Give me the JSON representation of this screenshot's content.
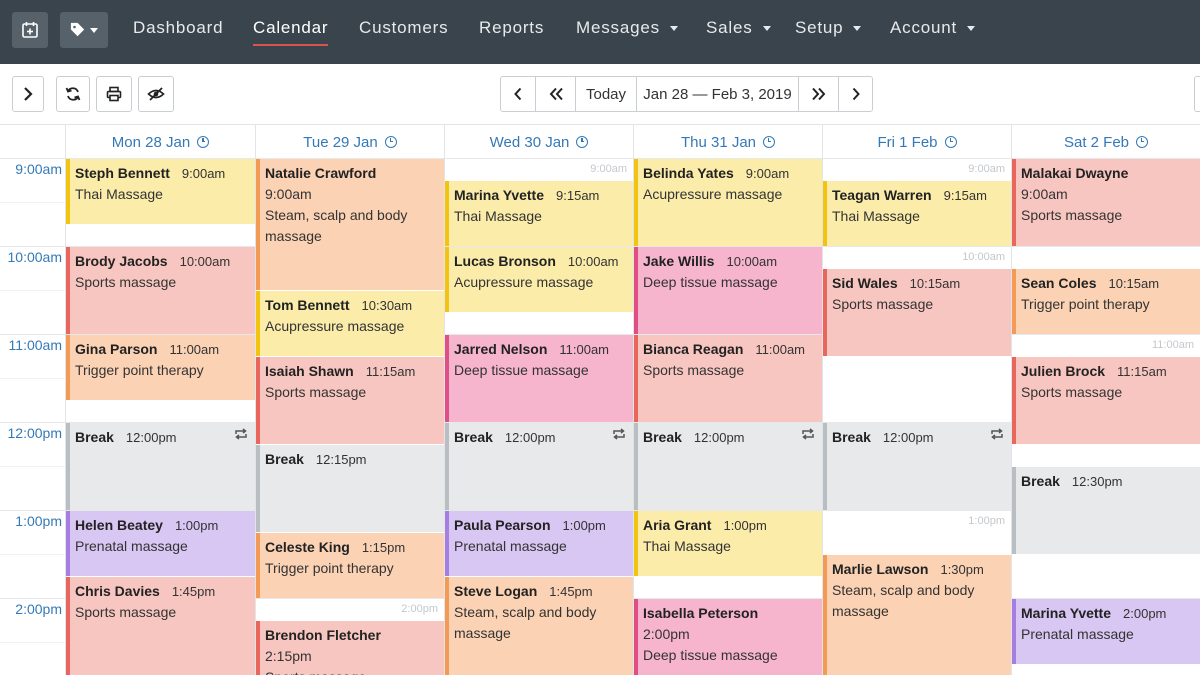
{
  "nav": {
    "items": [
      {
        "label": "Dashboard",
        "dropdown": false,
        "active": false
      },
      {
        "label": "Calendar",
        "dropdown": false,
        "active": true
      },
      {
        "label": "Customers",
        "dropdown": false,
        "active": false
      },
      {
        "label": "Reports",
        "dropdown": false,
        "active": false
      },
      {
        "label": "Messages",
        "dropdown": true,
        "active": false
      },
      {
        "label": "Sales",
        "dropdown": true,
        "active": false
      },
      {
        "label": "Setup",
        "dropdown": true,
        "active": false
      },
      {
        "label": "Account",
        "dropdown": true,
        "active": false
      }
    ]
  },
  "toolbar": {
    "today_label": "Today",
    "date_range": "Jan 28 — Feb 3, 2019"
  },
  "days": [
    {
      "label": "Mon 28 Jan"
    },
    {
      "label": "Tue 29 Jan"
    },
    {
      "label": "Wed 30 Jan"
    },
    {
      "label": "Thu 31 Jan"
    },
    {
      "label": "Fri 1 Feb"
    },
    {
      "label": "Sat 2 Feb"
    }
  ],
  "time_labels": [
    "9:00am",
    "10:00am",
    "11:00am",
    "12:00pm",
    "1:00pm",
    "2:00pm"
  ],
  "empty_slots": [
    {
      "day": 2,
      "label": "9:00am"
    },
    {
      "day": 4,
      "label": "9:00am"
    },
    {
      "day": 4,
      "label": "10:00am"
    },
    {
      "day": 5,
      "label": "11:00am"
    },
    {
      "day": 4,
      "label": "1:00pm"
    },
    {
      "day": 1,
      "label": "2:00pm"
    }
  ],
  "appointments": [
    {
      "day": 0,
      "name": "Steph Bennett",
      "time": "9:00am",
      "service": "Thai Massage",
      "color": "yellow",
      "start": "9:00",
      "end": "9:45",
      "layout": "inline"
    },
    {
      "day": 0,
      "name": "Brody Jacobs",
      "time": "10:00am",
      "service": "Sports massage",
      "color": "red",
      "start": "10:00",
      "end": "11:00",
      "layout": "inline"
    },
    {
      "day": 0,
      "name": "Gina Parson",
      "time": "11:00am",
      "service": "Trigger point therapy",
      "color": "orange",
      "start": "11:00",
      "end": "11:45",
      "layout": "inline"
    },
    {
      "day": 0,
      "name": "Break",
      "time": "12:00pm",
      "service": "",
      "color": "grey",
      "start": "12:00",
      "end": "13:00",
      "layout": "inline",
      "repeat": true
    },
    {
      "day": 0,
      "name": "Helen Beatey",
      "time": "1:00pm",
      "service": "Prenatal massage",
      "color": "purple",
      "start": "13:00",
      "end": "13:45",
      "layout": "inline"
    },
    {
      "day": 0,
      "name": "Chris Davies",
      "time": "1:45pm",
      "service": "Sports massage",
      "color": "red",
      "start": "13:45",
      "end": "15:00",
      "layout": "inline"
    },
    {
      "day": 1,
      "name": "Natalie Crawford",
      "time": "9:00am",
      "service": "Steam, scalp and body massage",
      "color": "orange",
      "start": "9:00",
      "end": "10:30",
      "layout": "stacked"
    },
    {
      "day": 1,
      "name": "Tom Bennett",
      "time": "10:30am",
      "service": "Acupressure massage",
      "color": "yellow",
      "start": "10:30",
      "end": "11:15",
      "layout": "inline"
    },
    {
      "day": 1,
      "name": "Isaiah Shawn",
      "time": "11:15am",
      "service": "Sports massage",
      "color": "red",
      "start": "11:15",
      "end": "12:15",
      "layout": "inline"
    },
    {
      "day": 1,
      "name": "Break",
      "time": "12:15pm",
      "service": "",
      "color": "grey",
      "start": "12:15",
      "end": "13:15",
      "layout": "inline"
    },
    {
      "day": 1,
      "name": "Celeste King",
      "time": "1:15pm",
      "service": "Trigger point therapy",
      "color": "orange",
      "start": "13:15",
      "end": "14:00",
      "layout": "inline"
    },
    {
      "day": 1,
      "name": "Brendon Fletcher",
      "time": "2:15pm",
      "service": "Sports massage",
      "color": "red",
      "start": "14:15",
      "end": "15:00",
      "layout": "stacked"
    },
    {
      "day": 2,
      "name": "Marina Yvette",
      "time": "9:15am",
      "service": "Thai Massage",
      "color": "yellow",
      "start": "9:15",
      "end": "10:00",
      "layout": "inline"
    },
    {
      "day": 2,
      "name": "Lucas Bronson",
      "time": "10:00am",
      "service": "Acupressure massage",
      "color": "yellow",
      "start": "10:00",
      "end": "10:45",
      "layout": "inline"
    },
    {
      "day": 2,
      "name": "Jarred Nelson",
      "time": "11:00am",
      "service": "Deep tissue massage",
      "color": "pink",
      "start": "11:00",
      "end": "12:00",
      "layout": "inline"
    },
    {
      "day": 2,
      "name": "Break",
      "time": "12:00pm",
      "service": "",
      "color": "grey",
      "start": "12:00",
      "end": "13:00",
      "layout": "inline",
      "repeat": true
    },
    {
      "day": 2,
      "name": "Paula Pearson",
      "time": "1:00pm",
      "service": "Prenatal massage",
      "color": "purple",
      "start": "13:00",
      "end": "13:45",
      "layout": "inline"
    },
    {
      "day": 2,
      "name": "Steve Logan",
      "time": "1:45pm",
      "service": "Steam, scalp and body massage",
      "color": "orange",
      "start": "13:45",
      "end": "15:00",
      "layout": "inline"
    },
    {
      "day": 3,
      "name": "Belinda Yates",
      "time": "9:00am",
      "service": "Acupressure massage",
      "color": "yellow",
      "start": "9:00",
      "end": "10:00",
      "layout": "inline"
    },
    {
      "day": 3,
      "name": "Jake Willis",
      "time": "10:00am",
      "service": "Deep tissue massage",
      "color": "pink",
      "start": "10:00",
      "end": "11:00",
      "layout": "inline"
    },
    {
      "day": 3,
      "name": "Bianca Reagan",
      "time": "11:00am",
      "service": "Sports massage",
      "color": "red",
      "start": "11:00",
      "end": "12:00",
      "layout": "inline"
    },
    {
      "day": 3,
      "name": "Break",
      "time": "12:00pm",
      "service": "",
      "color": "grey",
      "start": "12:00",
      "end": "13:00",
      "layout": "inline",
      "repeat": true
    },
    {
      "day": 3,
      "name": "Aria Grant",
      "time": "1:00pm",
      "service": "Thai Massage",
      "color": "yellow",
      "start": "13:00",
      "end": "13:45",
      "layout": "inline"
    },
    {
      "day": 3,
      "name": "Isabella Peterson",
      "time": "2:00pm",
      "service": "Deep tissue massage",
      "color": "pink",
      "start": "14:00",
      "end": "15:00",
      "layout": "stacked"
    },
    {
      "day": 4,
      "name": "Teagan Warren",
      "time": "9:15am",
      "service": "Thai Massage",
      "color": "yellow",
      "start": "9:15",
      "end": "10:00",
      "layout": "inline"
    },
    {
      "day": 4,
      "name": "Sid Wales",
      "time": "10:15am",
      "service": "Sports massage",
      "color": "red",
      "start": "10:15",
      "end": "11:15",
      "layout": "inline"
    },
    {
      "day": 4,
      "name": "Break",
      "time": "12:00pm",
      "service": "",
      "color": "grey",
      "start": "12:00",
      "end": "13:00",
      "layout": "inline",
      "repeat": true
    },
    {
      "day": 4,
      "name": "Marlie Lawson",
      "time": "1:30pm",
      "service": "Steam, scalp and body massage",
      "color": "orange",
      "start": "13:30",
      "end": "15:00",
      "layout": "inline"
    },
    {
      "day": 5,
      "name": "Malakai Dwayne",
      "time": "9:00am",
      "service": "Sports massage",
      "color": "red",
      "start": "9:00",
      "end": "10:00",
      "layout": "stacked"
    },
    {
      "day": 5,
      "name": "Sean Coles",
      "time": "10:15am",
      "service": "Trigger point therapy",
      "color": "orange",
      "start": "10:15",
      "end": "11:00",
      "layout": "inline"
    },
    {
      "day": 5,
      "name": "Julien Brock",
      "time": "11:15am",
      "service": "Sports massage",
      "color": "red",
      "start": "11:15",
      "end": "12:15",
      "layout": "inline"
    },
    {
      "day": 5,
      "name": "Break",
      "time": "12:30pm",
      "service": "",
      "color": "grey",
      "start": "12:30",
      "end": "13:30",
      "layout": "inline"
    },
    {
      "day": 5,
      "name": "Marina Yvette",
      "time": "2:00pm",
      "service": "Prenatal massage",
      "color": "purple",
      "start": "14:00",
      "end": "14:45",
      "layout": "inline"
    }
  ]
}
